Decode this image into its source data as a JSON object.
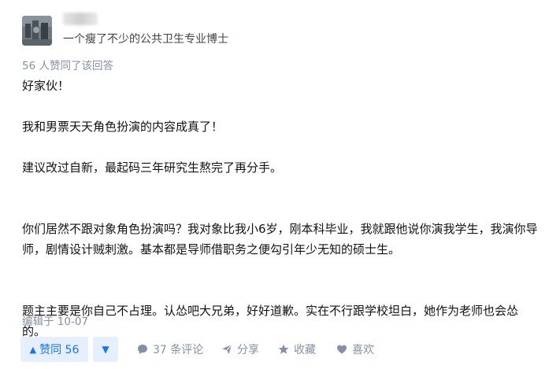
{
  "author": {
    "headline": "一个瘦了不少的公共卫生专业博士"
  },
  "upvote_summary": "56 人赞同了该回答",
  "content": {
    "p1": "好家伙！",
    "p2": "我和男票天天角色扮演的内容成真了！",
    "p3": "建议改过自新，最起码三年研究生熬完了再分手。",
    "p4_line1": "你们居然不跟对象角色扮演吗？我对象比我小6岁，刚本科毕业，我就跟他说你演我学生，我演你导",
    "p4_line2": "师，剧情设计贼刺激。基本都是导师借职务之便勾引年少无知的硕士生。",
    "p5_line1": "题主主要是你自己不占理。认怂吧大兄弟，好好道歉。实在不行跟学校坦白，她作为老师也会怂",
    "p5_line2": "的。"
  },
  "edited": "编辑于 10-07",
  "actions": {
    "vote_up_label": "赞同 56",
    "comments": "37 条评论",
    "share": "分享",
    "collect": "收藏",
    "like": "喜欢"
  },
  "icons": {
    "vote_up": "triangle-up-icon",
    "vote_down": "triangle-down-icon",
    "comment": "comment-bubble-icon",
    "share": "paper-plane-icon",
    "collect": "star-icon",
    "like": "heart-icon"
  },
  "colors": {
    "accent": "#1772f6",
    "vote_bg": "#e5effd",
    "muted": "#8590a6"
  }
}
